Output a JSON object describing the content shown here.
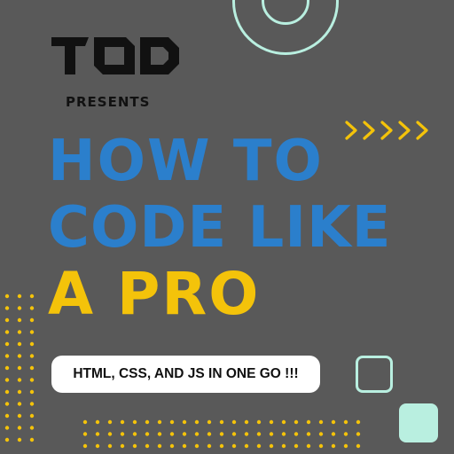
{
  "brand": {
    "logo_text": "TOD",
    "presents": "PRESENTS"
  },
  "headline": {
    "line1": "HOW TO",
    "line2": "CODE LIKE",
    "line3": "A PRO"
  },
  "tagline": "HTML, CSS, AND JS IN ONE GO !!!",
  "colors": {
    "background": "#595959",
    "blue": "#2b7fcc",
    "yellow": "#f4c30a",
    "mint": "#b9efe0",
    "dark": "#111111"
  }
}
